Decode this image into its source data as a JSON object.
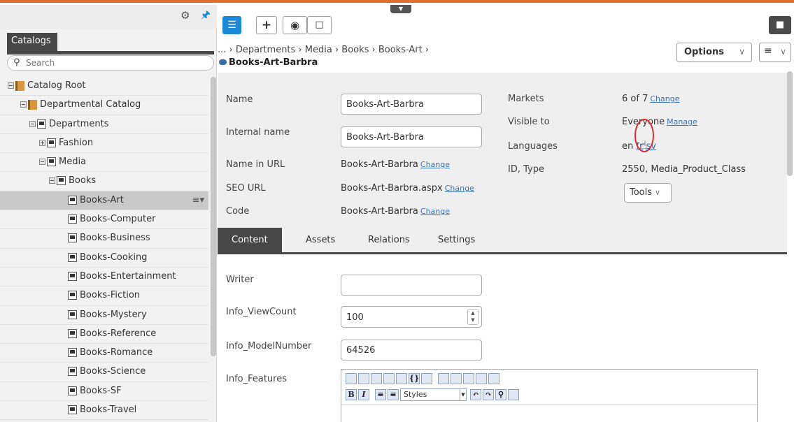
{
  "sidebar": {
    "tab_label": "Catalogs",
    "search_placeholder": "Search",
    "tree": [
      {
        "label": "Catalog Root"
      },
      {
        "label": "Departmental Catalog"
      },
      {
        "label": "Departments"
      },
      {
        "label": "Fashion"
      },
      {
        "label": "Media"
      },
      {
        "label": "Books"
      },
      {
        "label": "Books-Art",
        "selected": true
      },
      {
        "label": "Books-Computer"
      },
      {
        "label": "Books-Business"
      },
      {
        "label": "Books-Cooking"
      },
      {
        "label": "Books-Entertainment"
      },
      {
        "label": "Books-Fiction"
      },
      {
        "label": "Books-Mystery"
      },
      {
        "label": "Books-Reference"
      },
      {
        "label": "Books-Romance"
      },
      {
        "label": "Books-Science"
      },
      {
        "label": "Books-SF"
      },
      {
        "label": "Books-Travel"
      }
    ]
  },
  "header": {
    "breadcrumb": "... › Departments › Media › Books › Books-Art ›",
    "title": "Books-Art-Barbra",
    "options_label": "Options"
  },
  "properties": {
    "name_label": "Name",
    "name_value": "Books-Art-Barbra",
    "internal_name_label": "Internal name",
    "internal_name_value": "Books-Art-Barbra",
    "name_in_url_label": "Name in URL",
    "name_in_url_value": "Books-Art-Barbra",
    "seo_url_label": "SEO URL",
    "seo_url_value": "Books-Art-Barbra.aspx",
    "code_label": "Code",
    "code_value": "Books-Art-Barbra",
    "change_link": "Change",
    "markets_label": "Markets",
    "markets_value": "6 of 7",
    "visible_to_label": "Visible to",
    "visible_to_value": "Everyone",
    "manage_link": "Manage",
    "languages_label": "Languages",
    "lang_en": "en",
    "lang_fr": "fr",
    "lang_sv": "sv",
    "id_type_label": "ID, Type",
    "id_type_value": "2550, Media_Product_Class",
    "tools_label": "Tools"
  },
  "tabs": [
    {
      "label": "Content",
      "active": true
    },
    {
      "label": "Assets"
    },
    {
      "label": "Relations"
    },
    {
      "label": "Settings"
    }
  ],
  "content": {
    "writer_label": "Writer",
    "writer_value": "",
    "view_count_label": "Info_ViewCount",
    "view_count_value": "100",
    "model_number_label": "Info_ModelNumber",
    "model_number_value": "64526",
    "features_label": "Info_Features",
    "styles_label": "Styles"
  },
  "colors": {
    "accent_top": "#e36b2c",
    "primary_blue": "#1a8ad6",
    "dark_tab": "#474747",
    "highlight_circle": "#dd2c2c"
  }
}
